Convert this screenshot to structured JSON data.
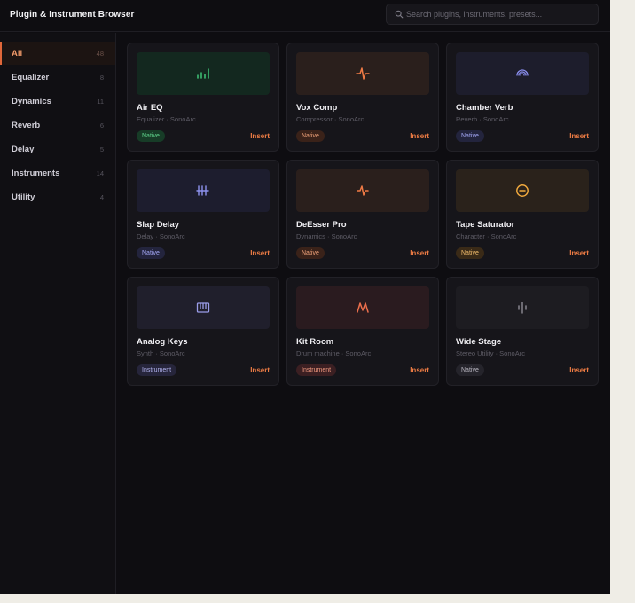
{
  "app": {
    "title": "Plugin & Instrument Browser"
  },
  "search": {
    "placeholder": "Search plugins, instruments, presets..."
  },
  "sidebar": {
    "items": [
      {
        "label": "All",
        "count": "48",
        "active": true
      },
      {
        "label": "Equalizer",
        "count": "8"
      },
      {
        "label": "Dynamics",
        "count": "11"
      },
      {
        "label": "Reverb",
        "count": "6"
      },
      {
        "label": "Delay",
        "count": "5"
      },
      {
        "label": "Instruments",
        "count": "14"
      },
      {
        "label": "Utility",
        "count": "4"
      }
    ]
  },
  "cards": [
    {
      "title": "Air EQ",
      "subtitle": "Equalizer · SonoArc",
      "badge": "Native",
      "action": "Insert",
      "icon": "equalizer-bars-icon",
      "thumb_color": "#13281f",
      "icon_color": "#3dbb72",
      "badge_bg": "#173c27",
      "badge_fg": "#5fd38c"
    },
    {
      "title": "Vox Comp",
      "subtitle": "Compressor · SonoArc",
      "badge": "Native",
      "action": "Insert",
      "icon": "waveform-pulse-icon",
      "thumb_color": "#2a1f1c",
      "icon_color": "#ef7a45",
      "badge_bg": "#3a2219",
      "badge_fg": "#f1a37a"
    },
    {
      "title": "Chamber Verb",
      "subtitle": "Reverb · SonoArc",
      "badge": "Native",
      "action": "Insert",
      "icon": "reverb-arcs-icon",
      "thumb_color": "#1d1d2c",
      "icon_color": "#8b8ff0",
      "badge_bg": "#23243d",
      "badge_fg": "#a3a7f5"
    },
    {
      "title": "Slap Delay",
      "subtitle": "Delay · SonoArc",
      "badge": "Native",
      "action": "Insert",
      "icon": "delay-taps-icon",
      "thumb_color": "#1d1d2e",
      "icon_color": "#8d92ee",
      "badge_bg": "#23243d",
      "badge_fg": "#a3a7f5"
    },
    {
      "title": "DeEsser Pro",
      "subtitle": "Dynamics · SonoArc",
      "badge": "Native",
      "action": "Insert",
      "icon": "waveform-pulse-icon",
      "thumb_color": "#2a1f1c",
      "icon_color": "#ef7a45",
      "badge_bg": "#3a2219",
      "badge_fg": "#f1a37a"
    },
    {
      "title": "Tape Saturator",
      "subtitle": "Character · SonoArc",
      "badge": "Native",
      "action": "Insert",
      "icon": "tape-circle-icon",
      "thumb_color": "#2a221b",
      "icon_color": "#f0a93e",
      "badge_bg": "#3a2a17",
      "badge_fg": "#f3bd6c"
    },
    {
      "title": "Analog Keys",
      "subtitle": "Synth · SonoArc",
      "badge": "Instrument",
      "action": "Insert",
      "icon": "piano-keys-icon",
      "thumb_color": "#201f2c",
      "icon_color": "#9a9ce8",
      "badge_bg": "#26253b",
      "badge_fg": "#b2b3ef"
    },
    {
      "title": "Kit Room",
      "subtitle": "Drum machine · SonoArc",
      "badge": "Instrument",
      "action": "Insert",
      "icon": "drum-peaks-icon",
      "thumb_color": "#2a1b1f",
      "icon_color": "#ec6f4c",
      "badge_bg": "#3b1f22",
      "badge_fg": "#f0997f"
    },
    {
      "title": "Wide Stage",
      "subtitle": "Stereo Utility · SonoArc",
      "badge": "Native",
      "action": "Insert",
      "icon": "stereo-width-icon",
      "thumb_color": "#1d1c21",
      "icon_color": "#8e8c96",
      "badge_bg": "#25242b",
      "badge_fg": "#b9b7c1"
    }
  ]
}
